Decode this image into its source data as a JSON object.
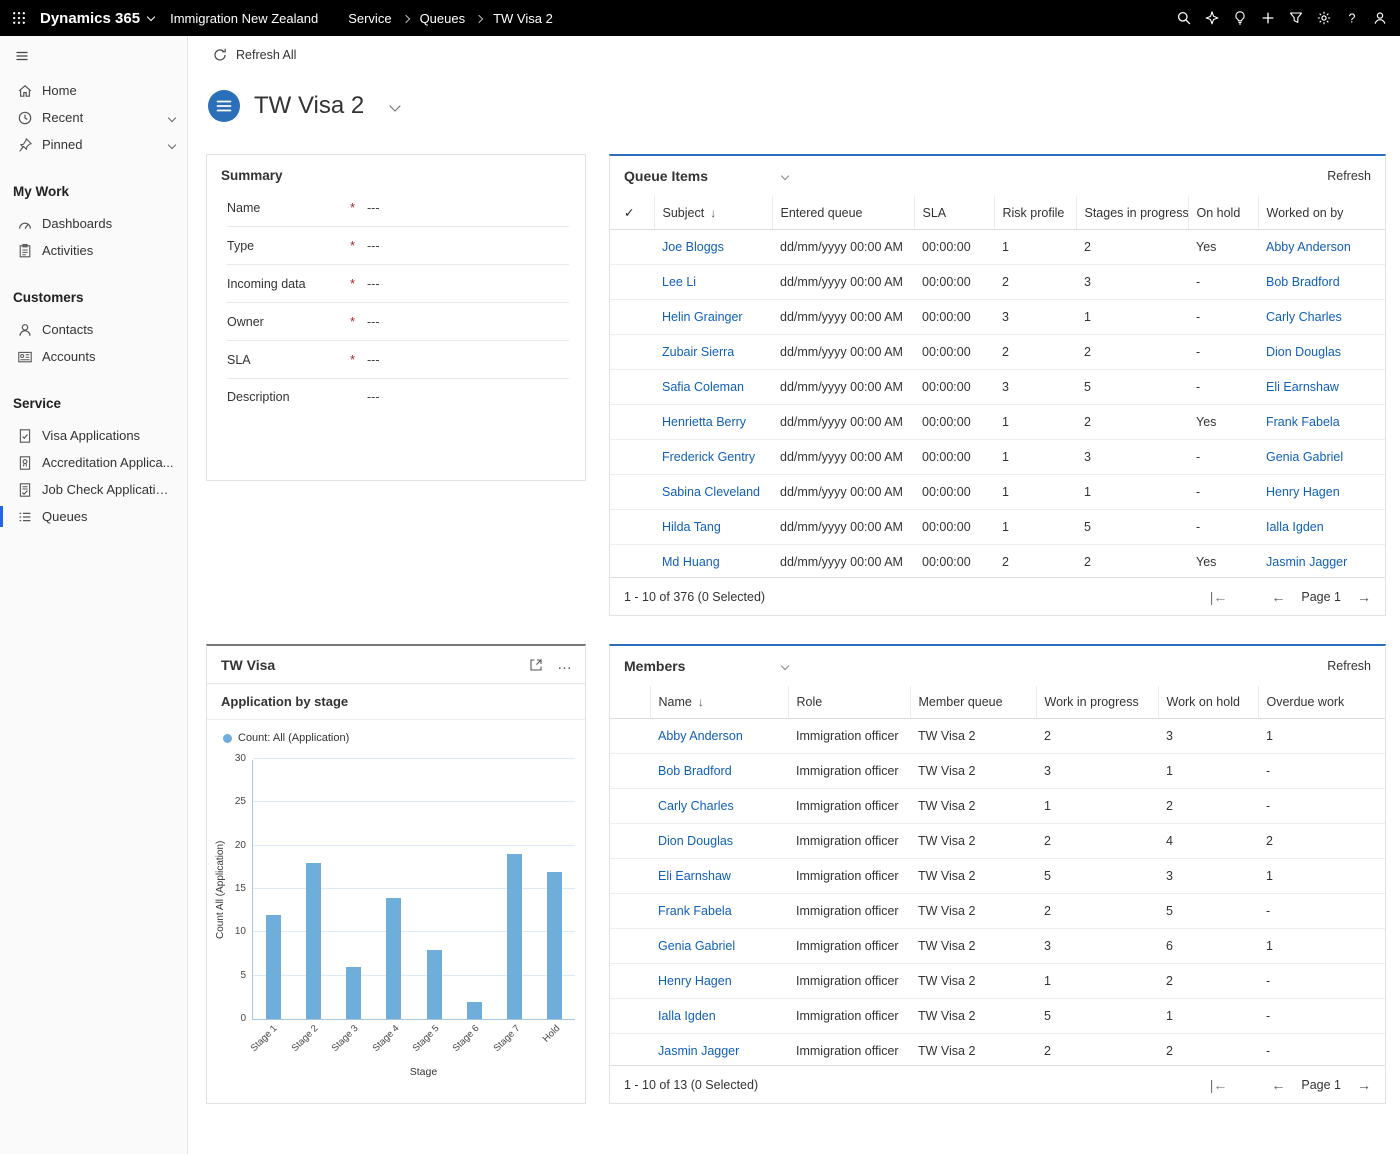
{
  "topbar": {
    "app_name": "Dynamics 365",
    "org_name": "Immigration New Zealand",
    "breadcrumb": [
      "Service",
      "Queues",
      "TW Visa 2"
    ],
    "icons": [
      "search-icon",
      "copilot-icon",
      "lightbulb-icon",
      "add-icon",
      "filter-icon",
      "settings-icon",
      "help-icon",
      "account-icon"
    ]
  },
  "command_bar": {
    "refresh_all_label": "Refresh All"
  },
  "page": {
    "title": "TW Visa 2"
  },
  "sidebar": {
    "top_items": [
      {
        "label": "Home",
        "icon": "home-icon"
      },
      {
        "label": "Recent",
        "icon": "clock-icon",
        "chevron": true
      },
      {
        "label": "Pinned",
        "icon": "pin-icon",
        "chevron": true
      }
    ],
    "sections": [
      {
        "header": "My Work",
        "items": [
          {
            "label": "Dashboards",
            "icon": "dashboard-icon"
          },
          {
            "label": "Activities",
            "icon": "activities-icon"
          }
        ]
      },
      {
        "header": "Customers",
        "items": [
          {
            "label": "Contacts",
            "icon": "contacts-icon"
          },
          {
            "label": "Accounts",
            "icon": "accounts-icon"
          }
        ]
      },
      {
        "header": "Service",
        "items": [
          {
            "label": "Visa Applications",
            "icon": "visa-applications-icon"
          },
          {
            "label": "Accreditation Applica...",
            "icon": "accreditation-icon"
          },
          {
            "label": "Job Check Applications",
            "icon": "job-check-icon"
          },
          {
            "label": "Queues",
            "icon": "queues-icon",
            "selected": true
          }
        ]
      }
    ]
  },
  "summary": {
    "title": "Summary",
    "fields": [
      {
        "label": "Name",
        "required": true,
        "value": "---"
      },
      {
        "label": "Type",
        "required": true,
        "value": "---"
      },
      {
        "label": "Incoming data",
        "required": true,
        "value": "---"
      },
      {
        "label": "Owner",
        "required": true,
        "value": "---"
      },
      {
        "label": "SLA",
        "required": true,
        "value": "---"
      },
      {
        "label": "Description",
        "required": false,
        "value": "---"
      }
    ]
  },
  "queue_items": {
    "title": "Queue Items",
    "refresh_label": "Refresh",
    "columns": [
      "Subject",
      "Entered queue",
      "SLA",
      "Risk profile",
      "Stages in progress",
      "On hold",
      "Worked on by"
    ],
    "rows": [
      {
        "subject": "Joe Bloggs",
        "entered_queue": "dd/mm/yyyy 00:00 AM",
        "sla": "00:00:00",
        "risk_profile": "1",
        "stages_in_progress": "2",
        "on_hold": "Yes",
        "worked_on_by": "Abby Anderson"
      },
      {
        "subject": "Lee Li",
        "entered_queue": "dd/mm/yyyy 00:00 AM",
        "sla": "00:00:00",
        "risk_profile": "2",
        "stages_in_progress": "3",
        "on_hold": "-",
        "worked_on_by": "Bob Bradford"
      },
      {
        "subject": "Helin Grainger",
        "entered_queue": "dd/mm/yyyy 00:00 AM",
        "sla": "00:00:00",
        "risk_profile": "3",
        "stages_in_progress": "1",
        "on_hold": "-",
        "worked_on_by": "Carly Charles"
      },
      {
        "subject": "Zubair Sierra",
        "entered_queue": "dd/mm/yyyy 00:00 AM",
        "sla": "00:00:00",
        "risk_profile": "2",
        "stages_in_progress": "2",
        "on_hold": "-",
        "worked_on_by": "Dion Douglas"
      },
      {
        "subject": "Safia Coleman",
        "entered_queue": "dd/mm/yyyy 00:00 AM",
        "sla": "00:00:00",
        "risk_profile": "3",
        "stages_in_progress": "5",
        "on_hold": "-",
        "worked_on_by": "Eli Earnshaw"
      },
      {
        "subject": "Henrietta Berry",
        "entered_queue": "dd/mm/yyyy 00:00 AM",
        "sla": "00:00:00",
        "risk_profile": "1",
        "stages_in_progress": "2",
        "on_hold": "Yes",
        "worked_on_by": "Frank Fabela"
      },
      {
        "subject": "Frederick Gentry",
        "entered_queue": "dd/mm/yyyy 00:00 AM",
        "sla": "00:00:00",
        "risk_profile": "1",
        "stages_in_progress": "3",
        "on_hold": "-",
        "worked_on_by": "Genia Gabriel"
      },
      {
        "subject": "Sabina Cleveland",
        "entered_queue": "dd/mm/yyyy 00:00 AM",
        "sla": "00:00:00",
        "risk_profile": "1",
        "stages_in_progress": "1",
        "on_hold": "-",
        "worked_on_by": "Henry Hagen"
      },
      {
        "subject": "Hilda Tang",
        "entered_queue": "dd/mm/yyyy 00:00 AM",
        "sla": "00:00:00",
        "risk_profile": "1",
        "stages_in_progress": "5",
        "on_hold": "-",
        "worked_on_by": "Ialla Igden"
      },
      {
        "subject": "Md Huang",
        "entered_queue": "dd/mm/yyyy 00:00 AM",
        "sla": "00:00:00",
        "risk_profile": "2",
        "stages_in_progress": "2",
        "on_hold": "Yes",
        "worked_on_by": "Jasmin Jagger"
      }
    ],
    "footer": "1 - 10 of 376 (0 Selected)"
  },
  "chart_card": {
    "title": "TW Visa",
    "subtitle": "Application by stage",
    "legend": "Count: All (Application)"
  },
  "chart_data": {
    "type": "bar",
    "title": "Application by stage",
    "categories": [
      "Stage 1",
      "Stage 2",
      "Stage 3",
      "Stage 4",
      "Stage 5",
      "Stage 6",
      "Stage 7",
      "Hold"
    ],
    "values": [
      12,
      18,
      6,
      14,
      8,
      2,
      19,
      17
    ],
    "xlabel": "Stage",
    "ylabel": "Count All (Application)",
    "ylim": [
      0,
      30
    ],
    "yticks": [
      0,
      5,
      10,
      15,
      20,
      25,
      30
    ],
    "legend": [
      "Count: All (Application)"
    ],
    "legend_position": "top-left",
    "grid": true,
    "bar_color": "#6fAEDB"
  },
  "members": {
    "title": "Members",
    "refresh_label": "Refresh",
    "columns": [
      "Name",
      "Role",
      "Member queue",
      "Work in progress",
      "Work on hold",
      "Overdue work"
    ],
    "rows": [
      {
        "name": "Abby Anderson",
        "role": "Immigration officer",
        "member_queue": "TW Visa 2",
        "work_in_progress": "2",
        "work_on_hold": "3",
        "overdue_work": "1"
      },
      {
        "name": "Bob Bradford",
        "role": "Immigration officer",
        "member_queue": "TW Visa 2",
        "work_in_progress": "3",
        "work_on_hold": "1",
        "overdue_work": "-"
      },
      {
        "name": "Carly Charles",
        "role": "Immigration officer",
        "member_queue": "TW Visa 2",
        "work_in_progress": "1",
        "work_on_hold": "2",
        "overdue_work": "-"
      },
      {
        "name": "Dion Douglas",
        "role": "Immigration officer",
        "member_queue": "TW Visa 2",
        "work_in_progress": "2",
        "work_on_hold": "4",
        "overdue_work": "2"
      },
      {
        "name": "Eli Earnshaw",
        "role": "Immigration officer",
        "member_queue": "TW Visa 2",
        "work_in_progress": "5",
        "work_on_hold": "3",
        "overdue_work": "1"
      },
      {
        "name": "Frank Fabela",
        "role": "Immigration officer",
        "member_queue": "TW Visa 2",
        "work_in_progress": "2",
        "work_on_hold": "5",
        "overdue_work": "-"
      },
      {
        "name": "Genia Gabriel",
        "role": "Immigration officer",
        "member_queue": "TW Visa 2",
        "work_in_progress": "3",
        "work_on_hold": "6",
        "overdue_work": "1"
      },
      {
        "name": "Henry Hagen",
        "role": "Immigration officer",
        "member_queue": "TW Visa 2",
        "work_in_progress": "1",
        "work_on_hold": "2",
        "overdue_work": "-"
      },
      {
        "name": "Ialla Igden",
        "role": "Immigration officer",
        "member_queue": "TW Visa 2",
        "work_in_progress": "5",
        "work_on_hold": "1",
        "overdue_work": "-"
      },
      {
        "name": "Jasmin Jagger",
        "role": "Immigration officer",
        "member_queue": "TW Visa 2",
        "work_in_progress": "2",
        "work_on_hold": "2",
        "overdue_work": "-"
      }
    ],
    "footer": "1 - 10 of 13 (0 Selected)"
  },
  "ui": {
    "check_glyph": "✓",
    "sort_glyph": "↓",
    "ellipsis_glyph": "…",
    "pager": {
      "first": "|←",
      "prev": "←",
      "label": "Page 1",
      "next": "→"
    }
  }
}
